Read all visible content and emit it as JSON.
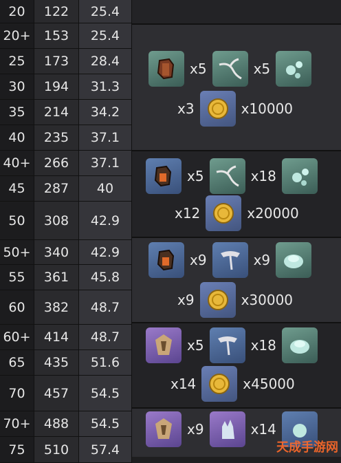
{
  "rows": [
    {
      "level": "20",
      "val1": "122",
      "val2": "25.4"
    },
    {
      "level": "20+",
      "val1": "153",
      "val2": "25.4"
    },
    {
      "level": "25",
      "val1": "173",
      "val2": "28.4"
    },
    {
      "level": "30",
      "val1": "194",
      "val2": "31.3"
    },
    {
      "level": "35",
      "val1": "214",
      "val2": "34.2"
    },
    {
      "level": "40",
      "val1": "235",
      "val2": "37.1"
    },
    {
      "level": "40+",
      "val1": "266",
      "val2": "37.1"
    },
    {
      "level": "45",
      "val1": "287",
      "val2": "40"
    },
    {
      "level": "50",
      "val1": "308",
      "val2": "42.9"
    },
    {
      "level": "50+",
      "val1": "340",
      "val2": "42.9"
    },
    {
      "level": "55",
      "val1": "361",
      "val2": "45.8"
    },
    {
      "level": "60",
      "val1": "382",
      "val2": "48.7"
    },
    {
      "level": "60+",
      "val1": "414",
      "val2": "48.7"
    },
    {
      "level": "65",
      "val1": "435",
      "val2": "51.6"
    },
    {
      "level": "70",
      "val1": "457",
      "val2": "54.5"
    },
    {
      "level": "70+",
      "val1": "488",
      "val2": "54.5"
    },
    {
      "level": "75",
      "val1": "510",
      "val2": "57.4"
    }
  ],
  "groups": [
    {
      "item1_qty": "x5",
      "item2_qty": "x5",
      "item3_qty": "x3",
      "mora_qty": "x10000"
    },
    {
      "item1_qty": "x5",
      "item2_qty": "x18",
      "item3_qty": "x12",
      "mora_qty": "x20000"
    },
    {
      "item1_qty": "x9",
      "item2_qty": "x9",
      "item3_qty": "x9",
      "mora_qty": "x30000"
    },
    {
      "item1_qty": "x5",
      "item2_qty": "x18",
      "item3_qty": "x14",
      "mora_qty": "x45000"
    },
    {
      "item1_qty": "x9",
      "item2_qty": "x14"
    }
  ],
  "watermark": "天成手游网"
}
